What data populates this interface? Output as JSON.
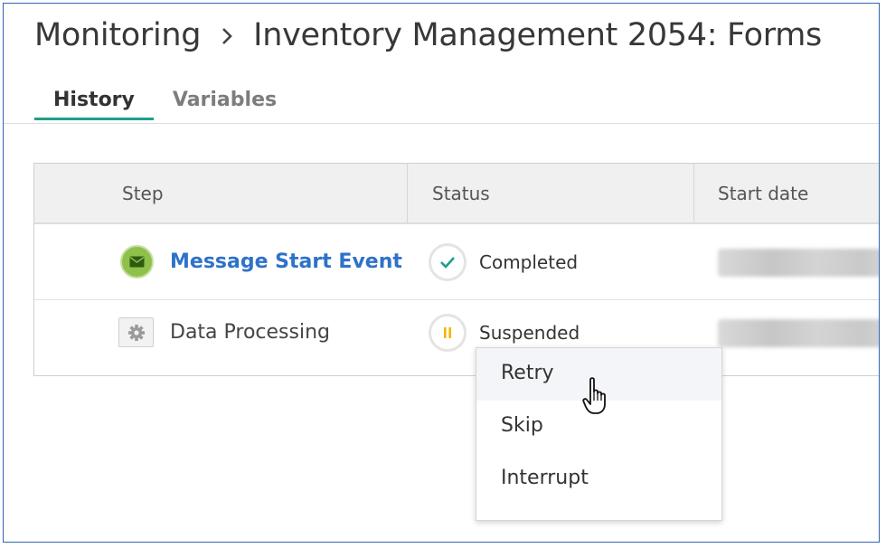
{
  "breadcrumb": {
    "root": "Monitoring",
    "current": "Inventory Management 2054: Forms"
  },
  "tabs": [
    {
      "label": "History",
      "active": true
    },
    {
      "label": "Variables",
      "active": false
    }
  ],
  "table": {
    "columns": [
      "Step",
      "Status",
      "Start date"
    ],
    "rows": [
      {
        "step": "Message Start Event",
        "step_icon": "envelope-icon",
        "status": "Completed",
        "status_icon": "check-icon"
      },
      {
        "step": "Data Processing",
        "step_icon": "gear-icon",
        "status": "Suspended",
        "status_icon": "pause-icon"
      }
    ]
  },
  "context_menu": {
    "items": [
      "Retry",
      "Skip",
      "Interrupt"
    ]
  },
  "colors": {
    "frame_border": "#2f66b3",
    "tab_underline": "#1e9e8a",
    "link": "#2e72c9",
    "event_icon_green": "#8fc04b",
    "completed_check": "#1e9e8a",
    "suspended_pause": "#f5b400"
  }
}
